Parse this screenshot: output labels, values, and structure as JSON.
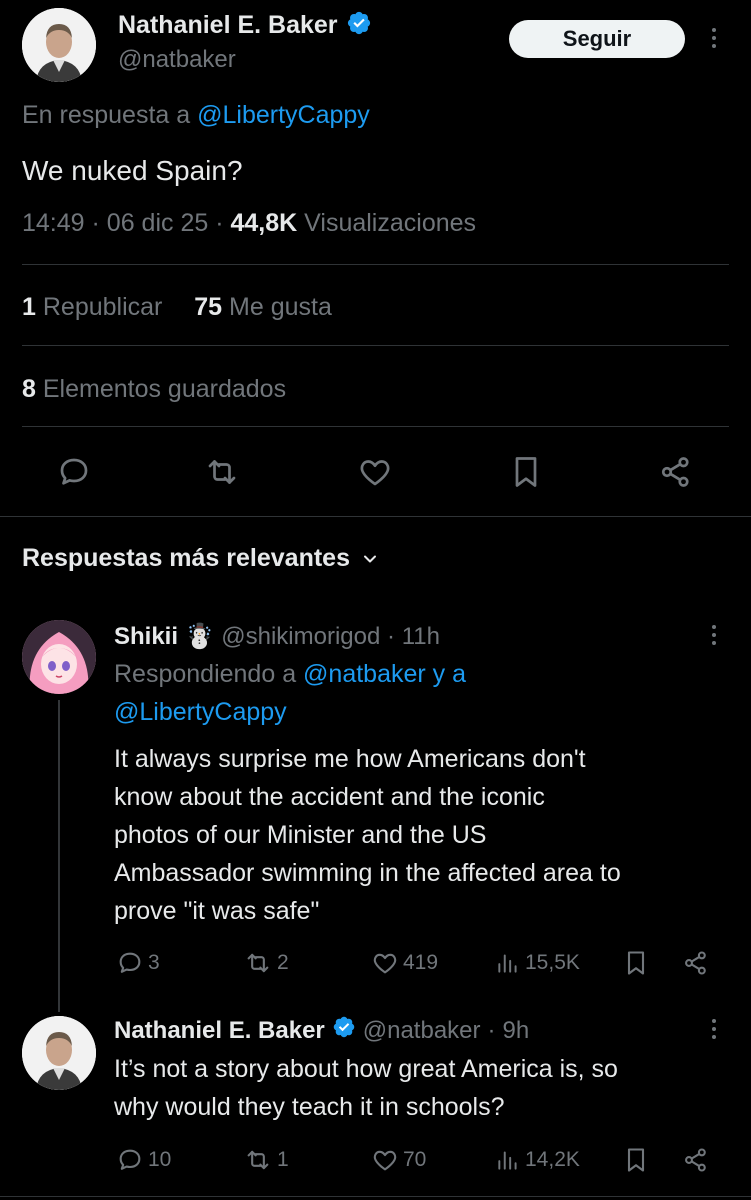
{
  "main_tweet": {
    "author_name": "Nathaniel E. Baker",
    "author_handle": "@natbaker",
    "follow_label": "Seguir",
    "reply_prefix": "En respuesta a",
    "reply_to": "@LibertyCappy",
    "text": "We nuked Spain?",
    "time": "14:49",
    "date": "06 dic 25",
    "views_count": "44,8K",
    "views_label": "Visualizaciones",
    "reposts_count": "1",
    "reposts_label": "Republicar",
    "likes_count": "75",
    "likes_label": "Me gusta",
    "bookmarks_count": "8",
    "bookmarks_label": "Elementos guardados"
  },
  "replies_header": {
    "label": "Respuestas más relevantes"
  },
  "replies": [
    {
      "author_name": "Shikii",
      "author_emoji": "☃️",
      "author_handle": "@shikimorigod",
      "time": "11h",
      "reply_prefix": "Respondiendo a",
      "reply_to_1": "@natbaker",
      "reply_conj": "y a",
      "reply_to_2": "@LibertyCappy",
      "text_lines": [
        "It always surprise me how Americans don't",
        "know about the accident and the iconic",
        "photos of our Minister and the US",
        "Ambassador swimming in the affected area to",
        "prove \"it was safe\""
      ],
      "replies_count": "3",
      "reposts_count": "2",
      "likes_count": "419",
      "views_count": "15,5K"
    },
    {
      "author_name": "Nathaniel E. Baker",
      "author_handle": "@natbaker",
      "time": "9h",
      "text_lines": [
        "It’s not a story about how great America is, so",
        "why would they teach it in schools?"
      ],
      "replies_count": "10",
      "reposts_count": "1",
      "likes_count": "70",
      "views_count": "14,2K"
    }
  ],
  "colors": {
    "background": "#000000",
    "text": "#e7e9ea",
    "muted": "#71767b",
    "link": "#1d9bf0",
    "divider": "#2f3336"
  }
}
